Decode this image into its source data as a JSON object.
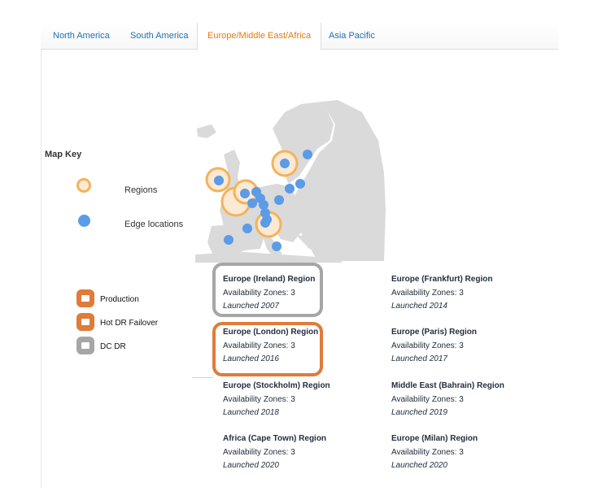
{
  "tabs": [
    {
      "label": "North America",
      "active": false
    },
    {
      "label": "South America",
      "active": false
    },
    {
      "label": "Europe/Middle East/Africa",
      "active": true
    },
    {
      "label": "Asia Pacific",
      "active": false
    }
  ],
  "map_key": {
    "title": "Map Key",
    "regions_label": "Regions",
    "edge_label": "Edge locations"
  },
  "legend": [
    {
      "label": "Production",
      "color": "#e07b39"
    },
    {
      "label": "Hot DR Failover",
      "color": "#e07b39"
    },
    {
      "label": "DC DR",
      "color": "#a6a6a6"
    }
  ],
  "regions": [
    {
      "name": "Europe (Ireland) Region",
      "az": "Availability Zones: 3",
      "launched": "Launched 2007"
    },
    {
      "name": "Europe (Frankfurt) Region",
      "az": "Availability Zones: 3",
      "launched": "Launched 2014"
    },
    {
      "name": "Europe (London) Region",
      "az": "Availability Zones: 3",
      "launched": "Launched 2016"
    },
    {
      "name": "Europe (Paris) Region",
      "az": "Availability Zones: 3",
      "launched": "Launched 2017"
    },
    {
      "name": "Europe (Stockholm) Region",
      "az": "Availability Zones: 3",
      "launched": "Launched 2018"
    },
    {
      "name": "Middle East (Bahrain) Region",
      "az": "Availability Zones: 3",
      "launched": "Launched 2019"
    },
    {
      "name": "Africa (Cape Town) Region",
      "az": "Availability Zones: 3",
      "launched": "Launched 2020"
    },
    {
      "name": "Europe (Milan) Region",
      "az": "Availability Zones: 3",
      "launched": "Launched 2020"
    }
  ],
  "colors": {
    "tab_link": "#1f6fb2",
    "tab_active": "#e47911",
    "production": "#e07b39",
    "dc_dr": "#a6a6a6",
    "edge": "#5b9be8",
    "region_ring": "#f3b35a"
  }
}
